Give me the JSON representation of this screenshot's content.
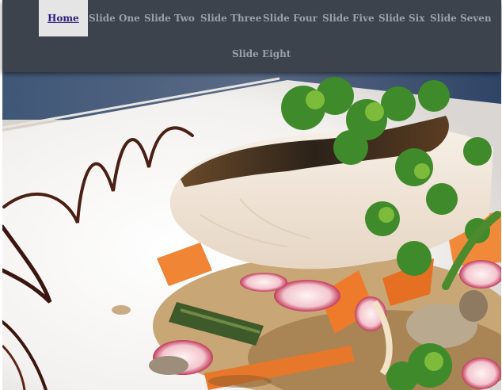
{
  "nav": {
    "items": [
      {
        "label": "Home",
        "active": true
      },
      {
        "label": "Slide One",
        "active": false
      },
      {
        "label": "Slide Two",
        "active": false
      },
      {
        "label": "Slide Three",
        "active": false
      },
      {
        "label": "Slide Four",
        "active": false
      },
      {
        "label": "Slide Five",
        "active": false
      },
      {
        "label": "Slide Six",
        "active": false
      },
      {
        "label": "Slide Seven",
        "active": false
      },
      {
        "label": "Slide Eight",
        "active": false
      }
    ]
  },
  "colors": {
    "nav_background": "#3d434d",
    "nav_text": "#9aa0aa",
    "active_background": "#e5e5e5",
    "active_text": "#2b1d80"
  },
  "hero": {
    "image": "plated-fish-dish-photo"
  }
}
